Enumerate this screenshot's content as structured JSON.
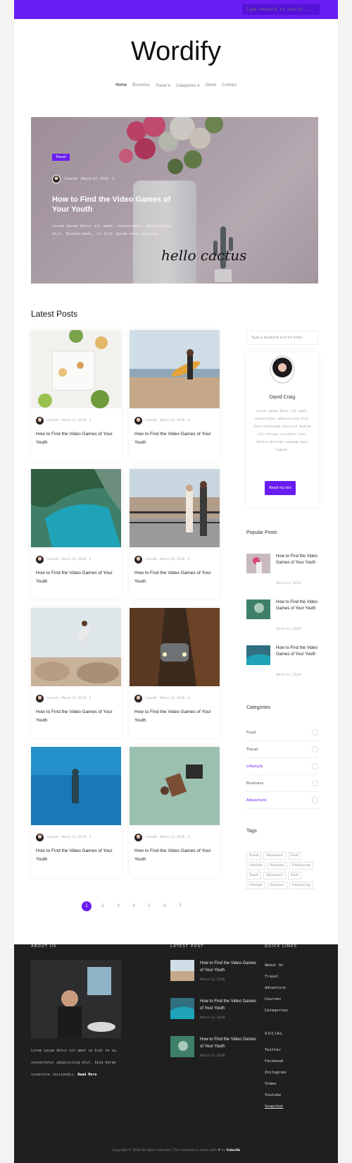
{
  "header": {
    "search_placeholder": "Type keyword to search...",
    "brand": "Wordify",
    "nav": [
      "Home",
      "Business",
      "Travel ▾",
      "Categories ▾",
      "About",
      "Contact"
    ]
  },
  "hero": {
    "badge": "Travel",
    "author": "Colorlib",
    "date": "March 12, 2018",
    "comments": "3",
    "title": "How to Find the Video Games of Your Youth",
    "excerpt": "Lorem ipsum dolor sit amet, consectetur adipisicing elit. Quidem modi, in illo ipsum esse ratione.",
    "image_text": "hello cactus"
  },
  "latest": {
    "heading": "Latest Posts",
    "posts": [
      {
        "author": "Colorlib",
        "date": "March 12, 2018",
        "comments": "3",
        "title": "How to Find the Video Games of Your Youth"
      },
      {
        "author": "Colorlib",
        "date": "March 12, 2018",
        "comments": "3",
        "title": "How to Find the Video Games of Your Youth"
      },
      {
        "author": "Colorlib",
        "date": "March 12, 2018",
        "comments": "3",
        "title": "How to Find the Video Games of Your Youth"
      },
      {
        "author": "Colorlib",
        "date": "March 12, 2018",
        "comments": "3",
        "title": "How to Find the Video Games of Your Youth"
      },
      {
        "author": "Colorlib",
        "date": "March 12, 2018",
        "comments": "3",
        "title": "How to Find the Video Games of Your Youth"
      },
      {
        "author": "Colorlib",
        "date": "March 12, 2018",
        "comments": "3",
        "title": "How to Find the Video Games of Your Youth"
      },
      {
        "author": "Colorlib",
        "date": "March 12, 2018",
        "comments": "3",
        "title": "How to Find the Video Games of Your Youth"
      },
      {
        "author": "Colorlib",
        "date": "March 12, 2018",
        "comments": "3",
        "title": "How to Find the Video Games of Your Youth"
      }
    ],
    "pages": [
      "1",
      "2",
      "3",
      "4",
      "5",
      "6",
      "7"
    ]
  },
  "sidebar": {
    "search_placeholder": "Type a keyword and hit enter",
    "profile": {
      "name": "David Craig",
      "bio": "Lorem ipsum dolor sit amet, consectetur adipisicing elit. Exercitationem nesciunt beatae sit ratione incidunt iste, dolore dolorem numquam quos fugiat.",
      "button": "Read my bio"
    },
    "popular_heading": "Popular Posts",
    "popular": [
      {
        "title": "How to Find the Video Games of Your Youth",
        "date": "March 12, 2018"
      },
      {
        "title": "How to Find the Video Games of Your Youth",
        "date": "March 12, 2018"
      },
      {
        "title": "How to Find the Video Games of Your Youth",
        "date": "March 12, 2018"
      }
    ],
    "categories_heading": "Categories",
    "categories": [
      "Food",
      "Travel",
      "Lifestyle",
      "Business",
      "Adventure"
    ],
    "tags_heading": "Tags",
    "tags": [
      "Travel",
      "Adventure",
      "Food",
      "Lifestyle",
      "Business",
      "Freelancing",
      "Travel",
      "Adventure",
      "Food",
      "Lifestyle",
      "Business",
      "Freelancing"
    ]
  },
  "footer": {
    "about_heading": "ABOUT US",
    "about_text": "Lorem ipsum dolor sit amet sa ksal sk sa, consectetur adipisicing elit. Ipsa harum inventore reiciendis.",
    "read_more": "Read More",
    "latest_heading": "LATEST POST",
    "latest": [
      {
        "title": "How to Find the Video Games of Your Youth",
        "date": "March 12, 2018"
      },
      {
        "title": "How to Find the Video Games of Your Youth",
        "date": "March 12, 2018"
      },
      {
        "title": "How to Find the Video Games of Your Youth",
        "date": "March 12, 2018"
      }
    ],
    "quick_heading": "QUICK LINKS",
    "quick_links": [
      "About Us",
      "Travel",
      "Adventure",
      "Courses",
      "Categories"
    ],
    "social_heading": "SOCIAL",
    "social_links": [
      "Twitter",
      "Facebook",
      "Instagram",
      "Vimeo",
      "Youtube",
      "Snapchat"
    ],
    "copyright": "Copyright © 2018 All rights reserved | This template is made with ♥ by",
    "copyright_brand": "Colorlib"
  },
  "colors": {
    "accent": "#6a1df2",
    "footer": "#1f1f1f"
  }
}
